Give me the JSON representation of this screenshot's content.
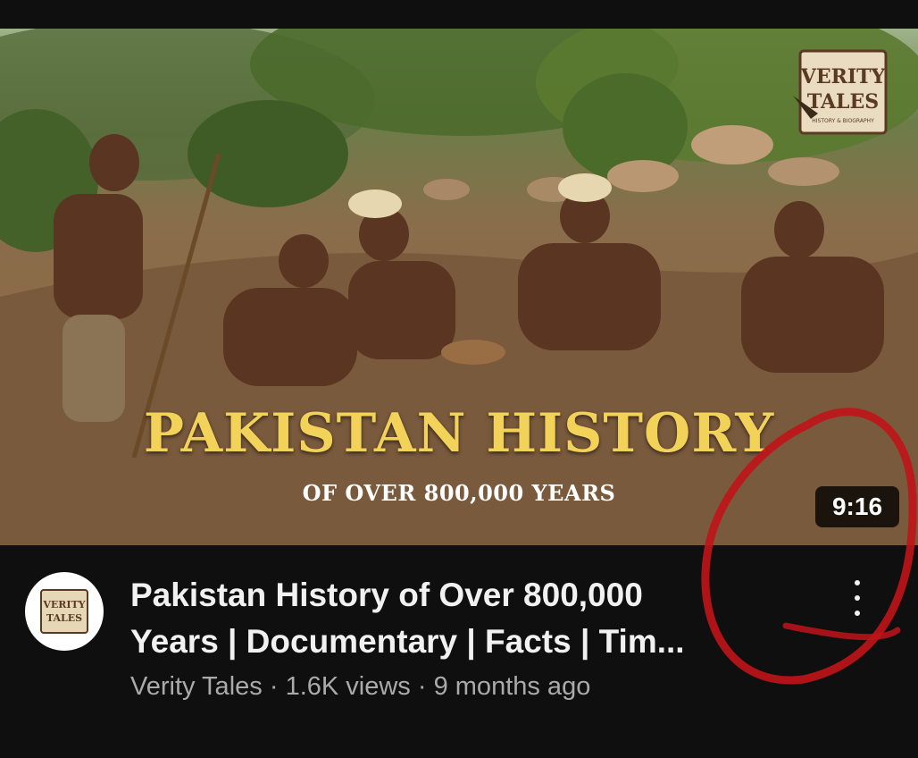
{
  "video": {
    "thumbnail": {
      "headline": "PAKISTAN HISTORY",
      "subheadline": "OF OVER 800,000 YEARS",
      "logo_line1": "VERITY",
      "logo_line2": "TALES",
      "logo_tagline": "HISTORY & BIOGRAPHY"
    },
    "duration": "9:16",
    "title_line1": "Pakistan History of Over 800,000",
    "title_line2": "Years | Documentary | Facts | Tim...",
    "channel": "Verity Tales",
    "views": "1.6K views",
    "age": "9 months ago",
    "separator": "·"
  },
  "avatar": {
    "line1": "VERITY",
    "line2": "TALES"
  },
  "colors": {
    "background": "#0f0f0f",
    "headline": "#f3d25a",
    "meta": "#aaaaaa",
    "annotation": "#c0141a"
  },
  "icons": {
    "more": "more-vert-icon"
  }
}
